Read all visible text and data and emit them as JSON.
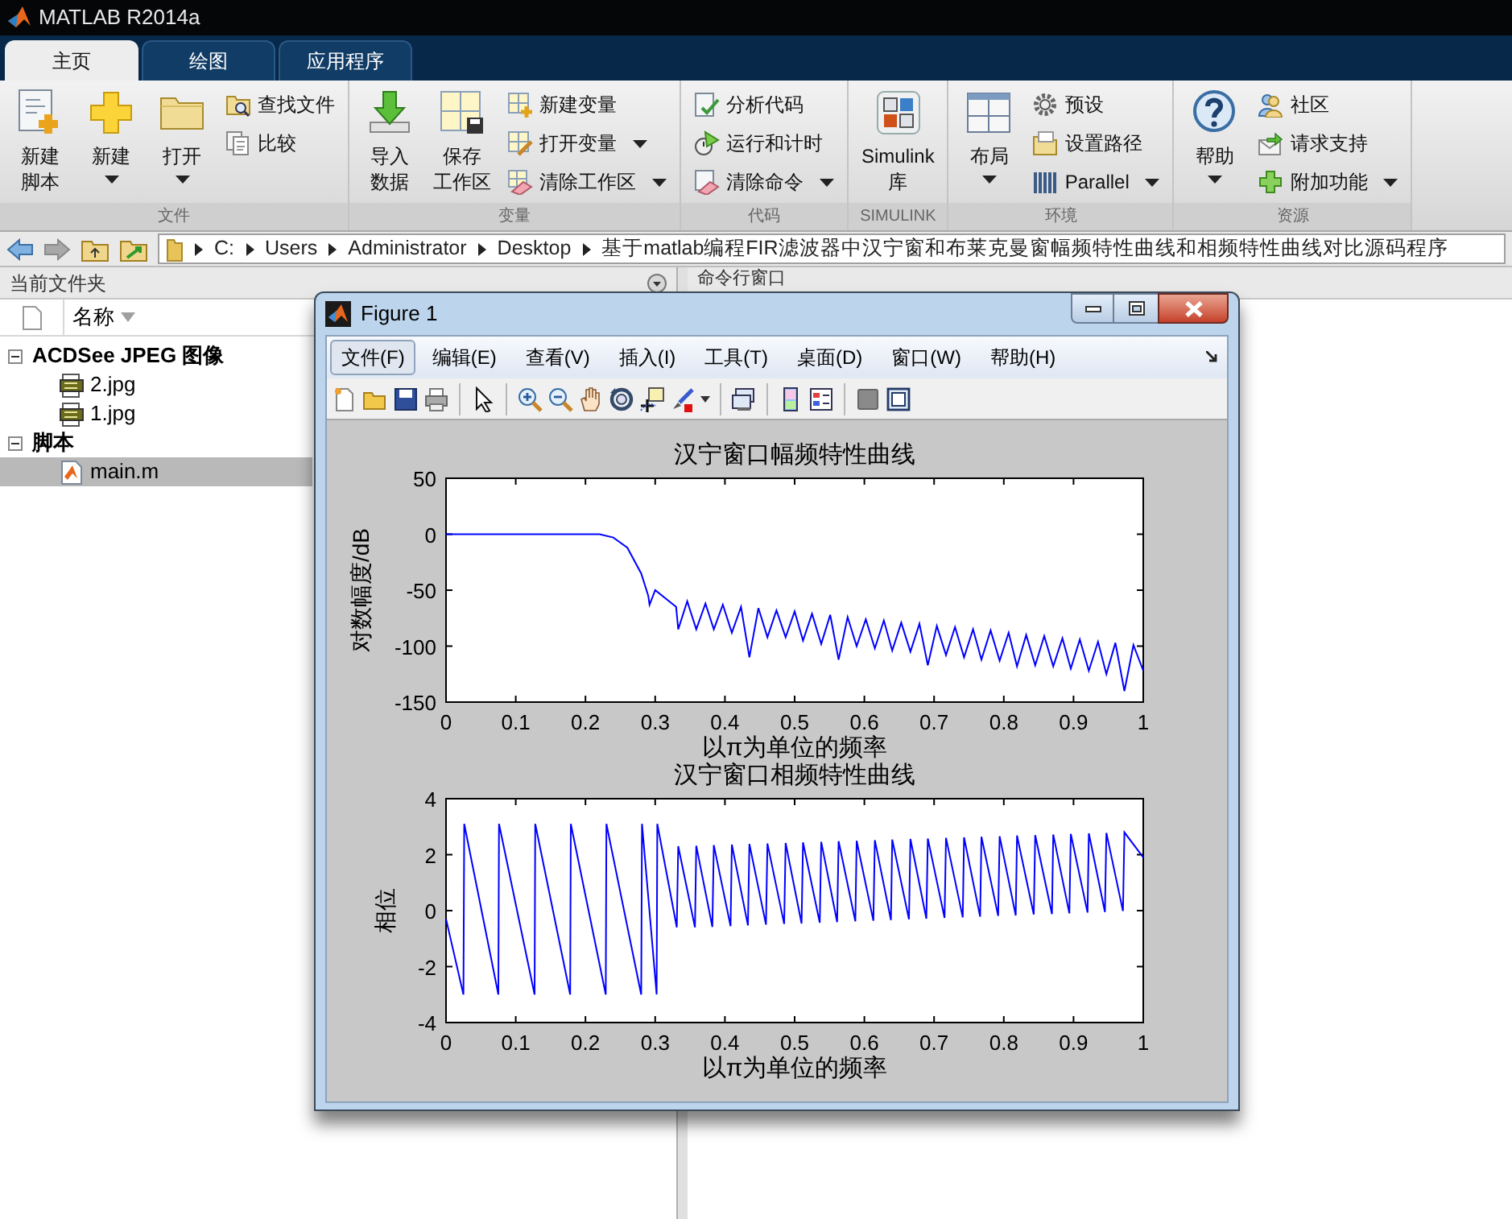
{
  "app": {
    "title": "MATLAB R2014a"
  },
  "tabs": [
    {
      "label": "主页",
      "selected": true
    },
    {
      "label": "绘图",
      "selected": false
    },
    {
      "label": "应用程序",
      "selected": false
    }
  ],
  "toolstrip": [
    {
      "label": "文件",
      "columns": [
        [
          {
            "kind": "large",
            "lines": [
              "新建",
              "脚本"
            ],
            "dropdown": false
          }
        ],
        [
          {
            "kind": "large",
            "lines": [
              "新建"
            ],
            "dropdown": true
          }
        ],
        [
          {
            "kind": "large",
            "lines": [
              "打开"
            ],
            "dropdown": true
          }
        ],
        [
          {
            "kind": "small",
            "lines": [
              "查找文件"
            ],
            "dropdown": false
          },
          {
            "kind": "small",
            "lines": [
              "比较"
            ],
            "dropdown": false
          }
        ]
      ]
    },
    {
      "label": "变量",
      "columns": [
        [
          {
            "kind": "large",
            "lines": [
              "导入",
              "数据"
            ],
            "dropdown": false
          }
        ],
        [
          {
            "kind": "large",
            "lines": [
              "保存",
              "工作区"
            ],
            "dropdown": false
          }
        ],
        [
          {
            "kind": "small",
            "lines": [
              "新建变量"
            ],
            "dropdown": false
          },
          {
            "kind": "small",
            "lines": [
              "打开变量"
            ],
            "dropdown": true
          },
          {
            "kind": "small",
            "lines": [
              "清除工作区"
            ],
            "dropdown": true
          }
        ]
      ]
    },
    {
      "label": "代码",
      "columns": [
        [
          {
            "kind": "small",
            "lines": [
              "分析代码"
            ],
            "dropdown": false
          },
          {
            "kind": "small",
            "lines": [
              "运行和计时"
            ],
            "dropdown": false
          },
          {
            "kind": "small",
            "lines": [
              "清除命令"
            ],
            "dropdown": true
          }
        ]
      ]
    },
    {
      "label": "SIMULINK",
      "columns": [
        [
          {
            "kind": "large",
            "lines": [
              "Simulink",
              "库"
            ],
            "dropdown": false
          }
        ]
      ]
    },
    {
      "label": "环境",
      "columns": [
        [
          {
            "kind": "large",
            "lines": [
              "布局"
            ],
            "dropdown": true
          }
        ],
        [
          {
            "kind": "small",
            "lines": [
              "预设"
            ],
            "dropdown": false
          },
          {
            "kind": "small",
            "lines": [
              "设置路径"
            ],
            "dropdown": false
          },
          {
            "kind": "small",
            "lines": [
              "Parallel"
            ],
            "dropdown": true
          }
        ]
      ]
    },
    {
      "label": "资源",
      "columns": [
        [
          {
            "kind": "large",
            "lines": [
              "帮助"
            ],
            "dropdown": true
          }
        ],
        [
          {
            "kind": "small",
            "lines": [
              "社区"
            ],
            "dropdown": false
          },
          {
            "kind": "small",
            "lines": [
              "请求支持"
            ],
            "dropdown": false
          },
          {
            "kind": "small",
            "lines": [
              "附加功能"
            ],
            "dropdown": true
          }
        ]
      ]
    }
  ],
  "address": {
    "path": [
      "C:",
      "Users",
      "Administrator",
      "Desktop",
      "基于matlab编程FIR滤波器中汉宁窗和布莱克曼窗幅频特性曲线和相频特性曲线对比源码程序"
    ]
  },
  "current_folder": {
    "title": "当前文件夹",
    "column": "名称",
    "tree": [
      {
        "label": "ACDSee JPEG 图像",
        "expanded": true,
        "children": [
          {
            "label": "2.jpg",
            "kind": "image",
            "selected": false
          },
          {
            "label": "1.jpg",
            "kind": "image",
            "selected": false
          }
        ]
      },
      {
        "label": "脚本",
        "expanded": true,
        "children": [
          {
            "label": "main.m",
            "kind": "script",
            "selected": true
          }
        ]
      }
    ]
  },
  "command_window": {
    "title": "命令行窗口"
  },
  "figure": {
    "title": "Figure 1",
    "menu": [
      {
        "label": "文件(F)",
        "selected": true
      },
      {
        "label": "编辑(E)",
        "selected": false
      },
      {
        "label": "查看(V)",
        "selected": false
      },
      {
        "label": "插入(I)",
        "selected": false
      },
      {
        "label": "工具(T)",
        "selected": false
      },
      {
        "label": "桌面(D)",
        "selected": false
      },
      {
        "label": "窗口(W)",
        "selected": false
      },
      {
        "label": "帮助(H)",
        "selected": false
      }
    ],
    "axes": [
      {
        "chart_data": {
          "type": "line",
          "title": "汉宁窗口幅频特性曲线",
          "xlabel": "以π为单位的频率",
          "ylabel": "对数幅度/dB",
          "xlim": [
            0,
            1
          ],
          "ylim": [
            -150,
            50
          ],
          "xticks": [
            0,
            0.1,
            0.2,
            0.3,
            0.4,
            0.5,
            0.6,
            0.7,
            0.8,
            0.9,
            1
          ],
          "yticks": [
            -150,
            -100,
            -50,
            0,
            50
          ],
          "x": [
            0,
            0.22,
            0.24,
            0.26,
            0.28,
            0.29,
            0.292,
            0.3,
            0.33,
            0.333,
            0.346,
            0.359,
            0.372,
            0.384,
            0.397,
            0.41,
            0.423,
            0.435,
            0.448,
            0.461,
            0.474,
            0.487,
            0.5,
            0.512,
            0.525,
            0.538,
            0.551,
            0.563,
            0.576,
            0.589,
            0.602,
            0.615,
            0.628,
            0.64,
            0.653,
            0.666,
            0.679,
            0.691,
            0.704,
            0.717,
            0.73,
            0.743,
            0.756,
            0.768,
            0.781,
            0.794,
            0.807,
            0.819,
            0.832,
            0.845,
            0.858,
            0.871,
            0.884,
            0.896,
            0.909,
            0.922,
            0.935,
            0.947,
            0.96,
            0.973,
            0.986,
            1
          ],
          "series": [
            {
              "color": "#0000ff",
              "values": [
                0,
                0,
                -3,
                -12,
                -35,
                -55,
                -63,
                -50,
                -65,
                -85,
                -60,
                -85,
                -62,
                -85,
                -63,
                -88,
                -65,
                -110,
                -66,
                -92,
                -68,
                -92,
                -69,
                -95,
                -71,
                -98,
                -72,
                -112,
                -74,
                -100,
                -76,
                -102,
                -77,
                -104,
                -79,
                -105,
                -80,
                -117,
                -82,
                -108,
                -83,
                -110,
                -85,
                -112,
                -86,
                -113,
                -88,
                -118,
                -90,
                -117,
                -91,
                -118,
                -93,
                -120,
                -94,
                -122,
                -96,
                -125,
                -97,
                -140,
                -99,
                -122
              ]
            }
          ]
        }
      },
      {
        "chart_data": {
          "type": "line",
          "title": "汉宁窗口相频特性曲线",
          "xlabel": "以π为单位的频率",
          "ylabel": "相位",
          "xlim": [
            0,
            1
          ],
          "ylim": [
            -4,
            4
          ],
          "xticks": [
            0,
            0.1,
            0.2,
            0.3,
            0.4,
            0.5,
            0.6,
            0.7,
            0.8,
            0.9,
            1
          ],
          "yticks": [
            -4,
            -2,
            0,
            2,
            4
          ],
          "x": [
            0,
            0.025,
            0.026,
            0.075,
            0.076,
            0.127,
            0.128,
            0.178,
            0.179,
            0.229,
            0.23,
            0.28,
            0.281,
            0.302,
            0.303,
            0.331,
            0.333,
            0.357,
            0.359,
            0.382,
            0.384,
            0.408,
            0.41,
            0.433,
            0.435,
            0.459,
            0.461,
            0.485,
            0.487,
            0.51,
            0.512,
            0.536,
            0.538,
            0.561,
            0.563,
            0.587,
            0.589,
            0.613,
            0.615,
            0.638,
            0.64,
            0.664,
            0.666,
            0.689,
            0.691,
            0.715,
            0.717,
            0.741,
            0.743,
            0.766,
            0.768,
            0.792,
            0.794,
            0.817,
            0.819,
            0.843,
            0.845,
            0.869,
            0.871,
            0.894,
            0.896,
            0.92,
            0.922,
            0.945,
            0.947,
            0.971,
            0.973,
            1
          ],
          "series": [
            {
              "color": "#0000ff",
              "values": [
                -0.3,
                -3,
                3.1,
                -3,
                3.1,
                -3,
                3.1,
                -3,
                3.1,
                -3,
                3.1,
                -3,
                3.1,
                -3,
                3.1,
                -0.6,
                2.3,
                -0.6,
                2.32,
                -0.58,
                2.34,
                -0.55,
                2.36,
                -0.53,
                2.38,
                -0.5,
                2.4,
                -0.48,
                2.42,
                -0.46,
                2.44,
                -0.43,
                2.46,
                -0.41,
                2.48,
                -0.38,
                2.5,
                -0.36,
                2.52,
                -0.34,
                2.54,
                -0.31,
                2.56,
                -0.29,
                2.58,
                -0.26,
                2.6,
                -0.24,
                2.62,
                -0.22,
                2.64,
                -0.19,
                2.66,
                -0.17,
                2.68,
                -0.14,
                2.7,
                -0.12,
                2.72,
                -0.1,
                2.74,
                -0.07,
                2.76,
                -0.05,
                2.78,
                -0.02,
                2.8,
                1.9
              ]
            }
          ]
        }
      }
    ]
  }
}
